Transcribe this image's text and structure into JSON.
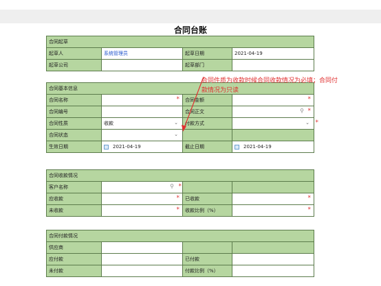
{
  "title": "合同台账",
  "colors": {
    "header_bg": "#b6d6a0",
    "border": "#5a7a4a",
    "required": "#e03030",
    "link": "#2255cc"
  },
  "registration": {
    "header": "合同起草",
    "drafter_label": "起草人",
    "drafter_value": "系统管理员",
    "draft_date_label": "起草日期",
    "draft_date_value": "2021-04-19",
    "company_label": "起草公司",
    "dept_label": "起草部门"
  },
  "basic": {
    "header": "合同基本信息",
    "name_label": "合同名称",
    "amount_label": "合同金额",
    "code_label": "合同编号",
    "text_label": "合同正文",
    "nature_label": "合同性质",
    "nature_value": "收款",
    "payment_method_label": "付款方式",
    "status_label": "合同状态",
    "effective_date_label": "生效日期",
    "effective_date_value": "2021-04-19",
    "end_date_label": "截止日期",
    "end_date_value": "2021-04-19"
  },
  "collection": {
    "header": "合同收款情况",
    "customer_label": "客户名称",
    "receivable_label": "应收款",
    "received_label": "已收款",
    "outstanding_label": "未收款",
    "ratio_label": "收款比例（%）"
  },
  "payment": {
    "header": "合同付款情况",
    "supplier_label": "供应商",
    "payable_label": "应付款",
    "paid_label": "已付款",
    "unpaid_label": "未付款",
    "ratio_label": "付款比例（%）"
  },
  "annotation": "合同件质为收款时候合同收款情况为必填；合同付款情况为只读",
  "icons": {
    "required": "*",
    "dropdown": "chevron-down-icon",
    "search": "search-icon",
    "calendar": "calendar-icon"
  }
}
